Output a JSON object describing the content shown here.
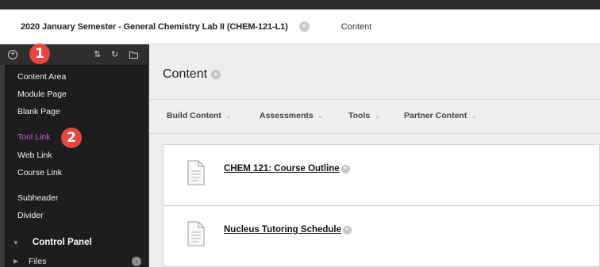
{
  "breadcrumb": {
    "course_title": "2020 January Semester - General Chemistry Lab II (CHEM-121-L1)",
    "current": "Content"
  },
  "sidebar": {
    "add_menu_items": [
      {
        "label": "Content Area",
        "active": false
      },
      {
        "label": "Module Page",
        "active": false
      },
      {
        "label": "Blank Page",
        "active": false
      },
      {
        "label": "Tool Link",
        "active": true
      },
      {
        "label": "Web Link",
        "active": false
      },
      {
        "label": "Course Link",
        "active": false
      },
      {
        "label": "Subheader",
        "active": false
      },
      {
        "label": "Divider",
        "active": false
      }
    ],
    "control_panel_label": "Control Panel",
    "files_label": "Files"
  },
  "markers": {
    "step1": "1",
    "step2": "2"
  },
  "main": {
    "page_title": "Content",
    "actions": [
      "Build Content",
      "Assessments",
      "Tools",
      "Partner Content"
    ],
    "items": [
      {
        "title": "CHEM 121: Course Outline"
      },
      {
        "title": "Nucleus Tutoring Schedule"
      }
    ]
  },
  "colors": {
    "active_menu_item": "#d45fd2",
    "marker": "#e8463d",
    "sidebar_bg": "#3b3b3b",
    "menu_bg": "#1d1d1d"
  },
  "icons": [
    "plus-icon",
    "sort-icon",
    "refresh-icon",
    "folder-icon",
    "document-icon",
    "chevron-down-icon"
  ]
}
